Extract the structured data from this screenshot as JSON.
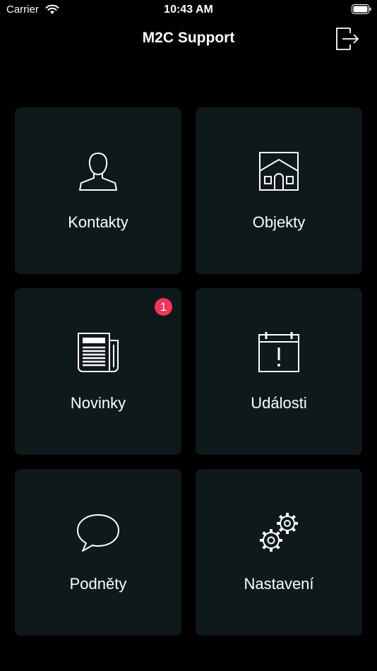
{
  "status_bar": {
    "carrier": "Carrier",
    "time": "10:43 AM"
  },
  "nav": {
    "title": "M2C Support",
    "logout_icon": "logout-icon"
  },
  "tiles": [
    {
      "label": "Kontakty",
      "icon": "person-icon"
    },
    {
      "label": "Objekty",
      "icon": "house-icon"
    },
    {
      "label": "Novinky",
      "icon": "newspaper-icon",
      "badge": "1"
    },
    {
      "label": "Události",
      "icon": "calendar-alert-icon"
    },
    {
      "label": "Podněty",
      "icon": "speech-bubble-icon"
    },
    {
      "label": "Nastavení",
      "icon": "gears-icon"
    }
  ],
  "colors": {
    "background": "#000000",
    "tile": "#0f181a",
    "badge": "#f0365a"
  }
}
